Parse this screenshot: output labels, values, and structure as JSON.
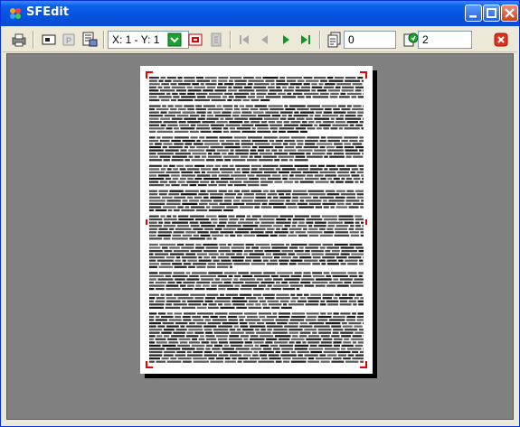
{
  "window": {
    "title": "SFEdit"
  },
  "toolbar": {
    "coords": "X: 1 - Y: 1",
    "page_count": "0",
    "page_number": "2"
  },
  "colors": {
    "title_blue": "#0553e0",
    "canvas_gray": "#808080",
    "accent_green": "#18a32e",
    "accent_red": "#e00000"
  },
  "icons": [
    "printer-icon",
    "screen-icon",
    "p-icon",
    "scan-icon",
    "green-check-icon",
    "red-box-icon",
    "gray-tool-icon",
    "first-page-icon",
    "prev-page-icon",
    "next-page-icon",
    "last-page-icon",
    "pages-icon",
    "page-green-icon",
    "close-red-icon"
  ]
}
